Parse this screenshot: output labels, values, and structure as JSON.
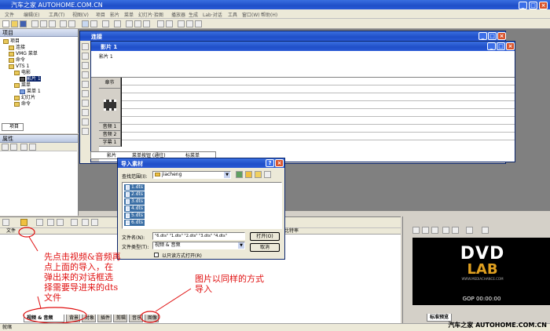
{
  "app": {
    "title": "汽车之家 AUTOHOME.COM.CN",
    "menu": [
      "文件",
      "编辑(E)",
      "工具(T)",
      "视图(V)",
      "项目",
      "影片",
      "菜单",
      "幻灯片·拾图",
      "播放器",
      "生成",
      "Lab·对话",
      "工具",
      "窗口(W)",
      "帮助(H)"
    ]
  },
  "project_panel": {
    "title": "项目",
    "tab_label": "项目",
    "tree": [
      {
        "label": "项目",
        "indent": 0,
        "icon": "folder"
      },
      {
        "label": "连接",
        "indent": 1,
        "icon": "folder"
      },
      {
        "label": "VMG 菜单",
        "indent": 1,
        "icon": "folder"
      },
      {
        "label": "命令",
        "indent": 1,
        "icon": "folder"
      },
      {
        "label": "VTS 1",
        "indent": 1,
        "icon": "folder"
      },
      {
        "label": "电影",
        "indent": 2,
        "icon": "folder"
      },
      {
        "label": "影片 1",
        "indent": 3,
        "icon": "film",
        "selected": true
      },
      {
        "label": "菜单",
        "indent": 2,
        "icon": "folder"
      },
      {
        "label": "菜单 1",
        "indent": 3,
        "icon": "blue"
      },
      {
        "label": "幻灯片",
        "indent": 2,
        "icon": "folder"
      },
      {
        "label": "命令",
        "indent": 2,
        "icon": "folder"
      }
    ]
  },
  "properties_panel": {
    "title": "属性"
  },
  "connect_window": {
    "title": "连接"
  },
  "movie_window": {
    "title": "影片 1",
    "header_label": "影片 1",
    "lanes": [
      "章节",
      "",
      "音频 1",
      "音频 2",
      "字幕 1"
    ],
    "menu_button_row": {
      "prefix": "影片",
      "label": "菜单按钮 (通往)",
      "value": "标菜单"
    }
  },
  "import_dialog": {
    "title": "导入素材",
    "lookin_label": "查找范围(I):",
    "lookin_value": "jiacheng",
    "files": [
      "1.dts",
      "2.dts",
      "3.dts",
      "4.dts",
      "5.dts",
      "6.dts"
    ],
    "filename_label": "文件名(N):",
    "filename_value": "\"6.dts\" \"1.dts\" \"2.dts\" \"3.dts\" \"4.dts\"",
    "filetype_label": "文件类型(T):",
    "filetype_value": "视频 & 音频",
    "readonly_label": "以只读方式打开(R)",
    "open_button": "打开(O)",
    "cancel_button": "取消"
  },
  "assets_panel": {
    "column_file": "文件",
    "column_bitrate": "比特率",
    "tabs": [
      "视频 & 音频",
      "背景",
      "对象",
      "插件",
      "剪辑",
      "音乐",
      "图像"
    ],
    "active_tab": "视频 & 音频"
  },
  "preview": {
    "logo_top": "DVD",
    "logo_bottom": "LAB",
    "logo_url": "WWW.MEDIACHANCE.COM",
    "gop_text": "GOP 00:00:00",
    "tab_label": "标准预览"
  },
  "annotations": {
    "left": "先点击视频&音频再点上面的导入，在弹出来的对话框选择需要导进来的dts文件",
    "right": "图片以同样的方式导入"
  },
  "status": {
    "left": "就绪",
    "watermark": "汽车之家 AUTOHOME.COM.CN"
  },
  "colors": {
    "xp_blue": "#1f4fc8",
    "annotation_red": "#e01010",
    "selection": "#3a6ea5"
  }
}
